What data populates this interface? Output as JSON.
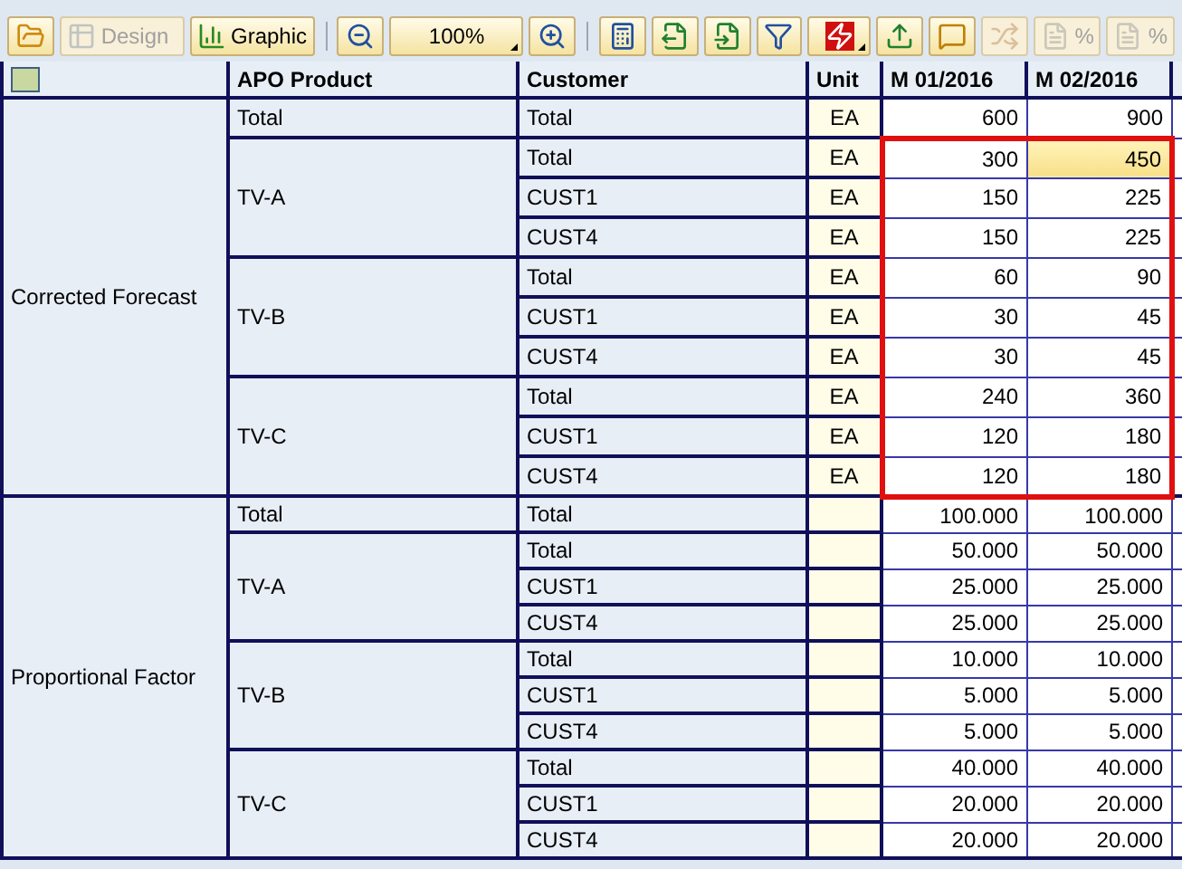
{
  "toolbar": [
    {
      "kind": "icon",
      "disabled": false
    },
    {
      "kind": "button",
      "label": "Design",
      "disabled": true
    },
    {
      "kind": "button",
      "label": "Graphic",
      "disabled": false
    },
    {
      "kind": "separator"
    },
    {
      "kind": "icon",
      "disabled": false
    },
    {
      "kind": "dropdown",
      "label": "100%",
      "disabled": false
    },
    {
      "kind": "icon",
      "disabled": false
    },
    {
      "kind": "separator"
    },
    {
      "kind": "icon",
      "disabled": false
    },
    {
      "kind": "icon",
      "disabled": false
    },
    {
      "kind": "icon",
      "disabled": false
    },
    {
      "kind": "icon",
      "disabled": false
    },
    {
      "kind": "dropdown",
      "disabled": false
    },
    {
      "kind": "icon",
      "disabled": false
    },
    {
      "kind": "icon",
      "disabled": false
    },
    {
      "kind": "icon",
      "disabled": true
    },
    {
      "kind": "button",
      "label": "%",
      "disabled": true
    },
    {
      "kind": "button",
      "label": "%",
      "disabled": true
    }
  ],
  "table": {
    "columns": [
      "APO Product",
      "Customer",
      "Unit",
      "M 01/2016",
      "M 02/2016"
    ],
    "sections": [
      {
        "label": "Corrected Forecast",
        "groups": [
          {
            "product": "Total",
            "outlined": false,
            "rows": [
              {
                "customer": "Total",
                "unit": "EA",
                "values": [
                  {
                    "text": "600",
                    "selected": false
                  },
                  {
                    "text": "900",
                    "selected": false
                  }
                ]
              }
            ]
          },
          {
            "product": "TV-A",
            "outlined": true,
            "rows": [
              {
                "customer": "Total",
                "unit": "EA",
                "values": [
                  {
                    "text": "300",
                    "selected": false
                  },
                  {
                    "text": "450",
                    "selected": true
                  }
                ]
              },
              {
                "customer": "CUST1",
                "unit": "EA",
                "values": [
                  {
                    "text": "150",
                    "selected": false
                  },
                  {
                    "text": "225",
                    "selected": false
                  }
                ]
              },
              {
                "customer": "CUST4",
                "unit": "EA",
                "values": [
                  {
                    "text": "150",
                    "selected": false
                  },
                  {
                    "text": "225",
                    "selected": false
                  }
                ]
              }
            ]
          },
          {
            "product": "TV-B",
            "outlined": true,
            "rows": [
              {
                "customer": "Total",
                "unit": "EA",
                "values": [
                  {
                    "text": "60",
                    "selected": false
                  },
                  {
                    "text": "90",
                    "selected": false
                  }
                ]
              },
              {
                "customer": "CUST1",
                "unit": "EA",
                "values": [
                  {
                    "text": "30",
                    "selected": false
                  },
                  {
                    "text": "45",
                    "selected": false
                  }
                ]
              },
              {
                "customer": "CUST4",
                "unit": "EA",
                "values": [
                  {
                    "text": "30",
                    "selected": false
                  },
                  {
                    "text": "45",
                    "selected": false
                  }
                ]
              }
            ]
          },
          {
            "product": "TV-C",
            "outlined": true,
            "rows": [
              {
                "customer": "Total",
                "unit": "EA",
                "values": [
                  {
                    "text": "240",
                    "selected": false
                  },
                  {
                    "text": "360",
                    "selected": false
                  }
                ]
              },
              {
                "customer": "CUST1",
                "unit": "EA",
                "values": [
                  {
                    "text": "120",
                    "selected": false
                  },
                  {
                    "text": "180",
                    "selected": false
                  }
                ]
              },
              {
                "customer": "CUST4",
                "unit": "EA",
                "values": [
                  {
                    "text": "120",
                    "selected": false
                  },
                  {
                    "text": "180",
                    "selected": false
                  }
                ]
              }
            ]
          }
        ]
      },
      {
        "label": "Proportional Factor",
        "groups": [
          {
            "product": "Total",
            "outlined": false,
            "rows": [
              {
                "customer": "Total",
                "values": [
                  {
                    "text": "100.000",
                    "selected": false
                  },
                  {
                    "text": "100.000",
                    "selected": false
                  }
                ]
              }
            ]
          },
          {
            "product": "TV-A",
            "outlined": false,
            "rows": [
              {
                "customer": "Total",
                "values": [
                  {
                    "text": "50.000",
                    "selected": false
                  },
                  {
                    "text": "50.000",
                    "selected": false
                  }
                ]
              },
              {
                "customer": "CUST1",
                "values": [
                  {
                    "text": "25.000",
                    "selected": false
                  },
                  {
                    "text": "25.000",
                    "selected": false
                  }
                ]
              },
              {
                "customer": "CUST4",
                "values": [
                  {
                    "text": "25.000",
                    "selected": false
                  },
                  {
                    "text": "25.000",
                    "selected": false
                  }
                ]
              }
            ]
          },
          {
            "product": "TV-B",
            "outlined": false,
            "rows": [
              {
                "customer": "Total",
                "values": [
                  {
                    "text": "10.000",
                    "selected": false
                  },
                  {
                    "text": "10.000",
                    "selected": false
                  }
                ]
              },
              {
                "customer": "CUST1",
                "values": [
                  {
                    "text": "5.000",
                    "selected": false
                  },
                  {
                    "text": "5.000",
                    "selected": false
                  }
                ]
              },
              {
                "customer": "CUST4",
                "values": [
                  {
                    "text": "5.000",
                    "selected": false
                  },
                  {
                    "text": "5.000",
                    "selected": false
                  }
                ]
              }
            ]
          },
          {
            "product": "TV-C",
            "outlined": false,
            "rows": [
              {
                "customer": "Total",
                "values": [
                  {
                    "text": "40.000",
                    "selected": false
                  },
                  {
                    "text": "40.000",
                    "selected": false
                  }
                ]
              },
              {
                "customer": "CUST1",
                "values": [
                  {
                    "text": "20.000",
                    "selected": false
                  },
                  {
                    "text": "20.000",
                    "selected": false
                  }
                ]
              },
              {
                "customer": "CUST4",
                "values": [
                  {
                    "text": "20.000",
                    "selected": false
                  },
                  {
                    "text": "20.000",
                    "selected": false
                  }
                ]
              }
            ]
          }
        ]
      }
    ]
  }
}
